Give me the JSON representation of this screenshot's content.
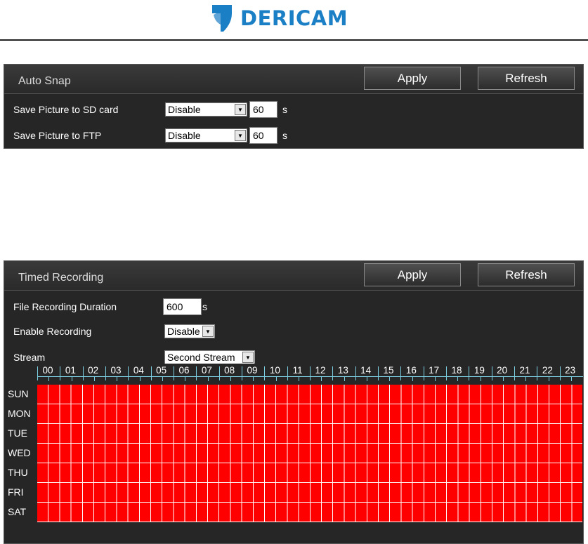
{
  "brand": {
    "name": "DERICAM",
    "color": "#1b7fc6"
  },
  "auto_snap": {
    "title": "Auto Snap",
    "apply_label": "Apply",
    "refresh_label": "Refresh",
    "rows": [
      {
        "label": "Save Picture to SD card",
        "select": "Disable",
        "value": "60",
        "unit": "s"
      },
      {
        "label": "Save Picture to FTP",
        "select": "Disable",
        "value": "60",
        "unit": "s"
      }
    ]
  },
  "timed_recording": {
    "title": "Timed Recording",
    "apply_label": "Apply",
    "refresh_label": "Refresh",
    "duration_label": "File Recording Duration",
    "duration_value": "600",
    "duration_unit": "s",
    "enable_label": "Enable Recording",
    "enable_value": "Disable",
    "stream_label": "Stream",
    "stream_value": "Second Stream",
    "hours": [
      "00",
      "01",
      "02",
      "03",
      "04",
      "05",
      "06",
      "07",
      "08",
      "09",
      "10",
      "11",
      "12",
      "13",
      "14",
      "15",
      "16",
      "17",
      "18",
      "19",
      "20",
      "21",
      "22",
      "23"
    ],
    "days": [
      "SUN",
      "MON",
      "TUE",
      "WED",
      "THU",
      "FRI",
      "SAT"
    ],
    "schedule_color": "#ff0000"
  }
}
